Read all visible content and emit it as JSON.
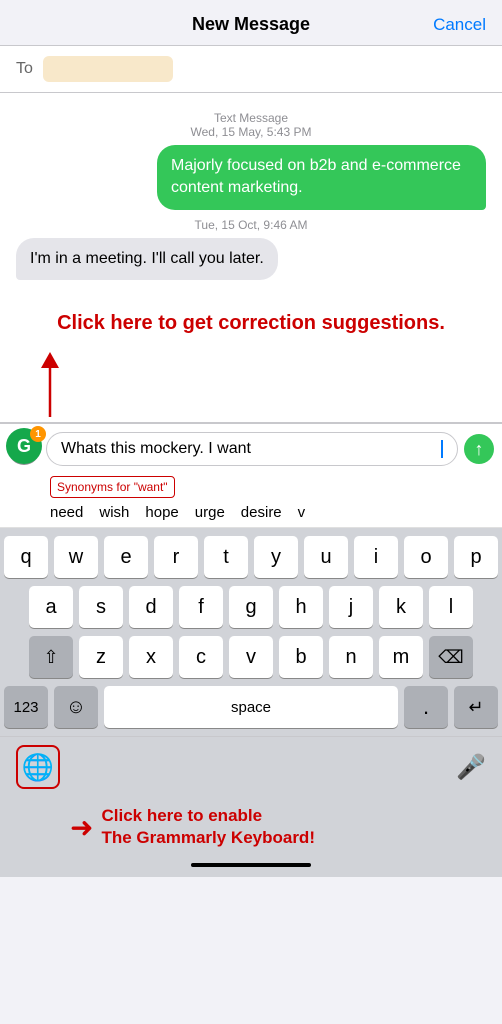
{
  "header": {
    "title": "New Message",
    "cancel_label": "Cancel"
  },
  "to_field": {
    "label": "To",
    "placeholder": ""
  },
  "messages": [
    {
      "type": "timestamp",
      "text": "Text Message\nWed, 15 May, 5:43 PM"
    },
    {
      "type": "outgoing",
      "text": "Majorly focused on b2b and e-commerce content marketing."
    },
    {
      "type": "timestamp",
      "text": "Tue, 15 Oct, 9:46 AM"
    },
    {
      "type": "incoming",
      "text": "I'm in a meeting. I'll call you later."
    }
  ],
  "correction_banner": {
    "text": "Click here to get correction suggestions."
  },
  "input_bar": {
    "message_text": "Whats this mockery. I want",
    "expand_icon": "›",
    "send_icon": "↑"
  },
  "synonyms": {
    "label": "Synonyms for \"want\"",
    "words": [
      "need",
      "wish",
      "hope",
      "urge",
      "desire",
      "v"
    ]
  },
  "keyboard": {
    "rows": [
      [
        "q",
        "w",
        "e",
        "r",
        "t",
        "y",
        "u",
        "i",
        "o",
        "p"
      ],
      [
        "a",
        "s",
        "d",
        "f",
        "g",
        "h",
        "j",
        "k",
        "l"
      ],
      [
        "⇧",
        "z",
        "x",
        "c",
        "v",
        "b",
        "n",
        "m",
        "⌫"
      ]
    ],
    "bottom": {
      "key123": "123",
      "emoji": "☺",
      "space": "space",
      "period": ".",
      "return": "↵"
    }
  },
  "bottom_bar": {
    "globe_label": "🌐",
    "microphone_label": "🎤"
  },
  "bottom_annotation": {
    "text": "Click here to enable\nThe Grammarly Keyboard!"
  },
  "grammarly": {
    "letter": "G",
    "badge": "1"
  }
}
